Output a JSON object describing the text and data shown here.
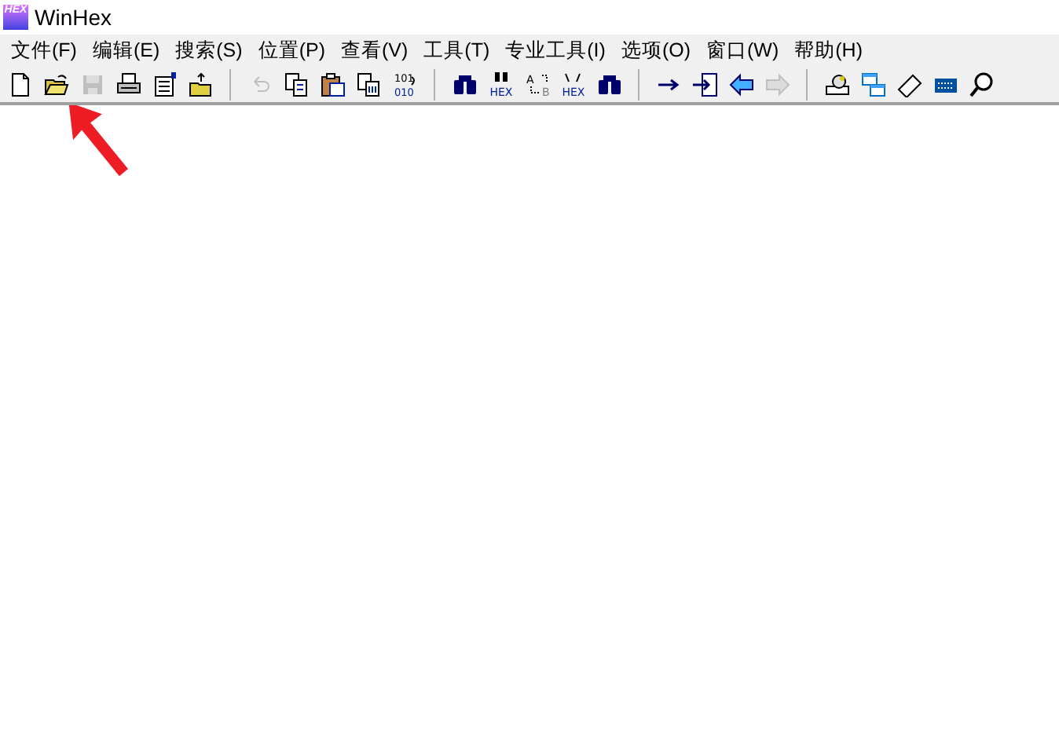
{
  "window": {
    "title": "WinHex",
    "logo_text": "HEX"
  },
  "menu": [
    {
      "label": "文件(F)"
    },
    {
      "label": "编辑(E)"
    },
    {
      "label": "搜索(S)"
    },
    {
      "label": "位置(P)"
    },
    {
      "label": "查看(V)"
    },
    {
      "label": "工具(T)"
    },
    {
      "label": "专业工具(I)"
    },
    {
      "label": "选项(O)"
    },
    {
      "label": "窗口(W)"
    },
    {
      "label": "帮助(H)"
    }
  ],
  "toolbar": [
    [
      {
        "kind": "new",
        "disabled": false
      },
      {
        "kind": "open",
        "disabled": false
      },
      {
        "kind": "save",
        "disabled": true
      },
      {
        "kind": "print",
        "disabled": false
      },
      {
        "kind": "properties",
        "disabled": false
      },
      {
        "kind": "open-folder",
        "disabled": false
      }
    ],
    [
      {
        "kind": "undo",
        "disabled": true
      },
      {
        "kind": "copy",
        "disabled": false
      },
      {
        "kind": "paste",
        "disabled": false
      },
      {
        "kind": "paste-special",
        "disabled": false
      },
      {
        "kind": "convert",
        "disabled": false,
        "caption": [
          "101",
          "010"
        ]
      }
    ],
    [
      {
        "kind": "find",
        "disabled": false
      },
      {
        "kind": "find-caption",
        "disabled": false,
        "caption": [
          "HEX"
        ]
      },
      {
        "kind": "replace",
        "disabled": false,
        "caption": [
          "A",
          "B"
        ]
      },
      {
        "kind": "replace-caption",
        "disabled": false,
        "caption": [
          "HEX"
        ]
      },
      {
        "kind": "find",
        "disabled": false
      }
    ],
    [
      {
        "kind": "arrow-right",
        "disabled": false
      },
      {
        "kind": "goto",
        "disabled": false
      },
      {
        "kind": "back",
        "disabled": false
      },
      {
        "kind": "forward",
        "disabled": true
      }
    ],
    [
      {
        "kind": "disk",
        "disabled": false
      },
      {
        "kind": "windows",
        "disabled": false
      },
      {
        "kind": "chip",
        "disabled": false
      },
      {
        "kind": "keyboard",
        "disabled": false
      },
      {
        "kind": "search",
        "disabled": false
      }
    ]
  ],
  "annotation": {
    "kind": "arrow",
    "color": "#ee1c25"
  }
}
